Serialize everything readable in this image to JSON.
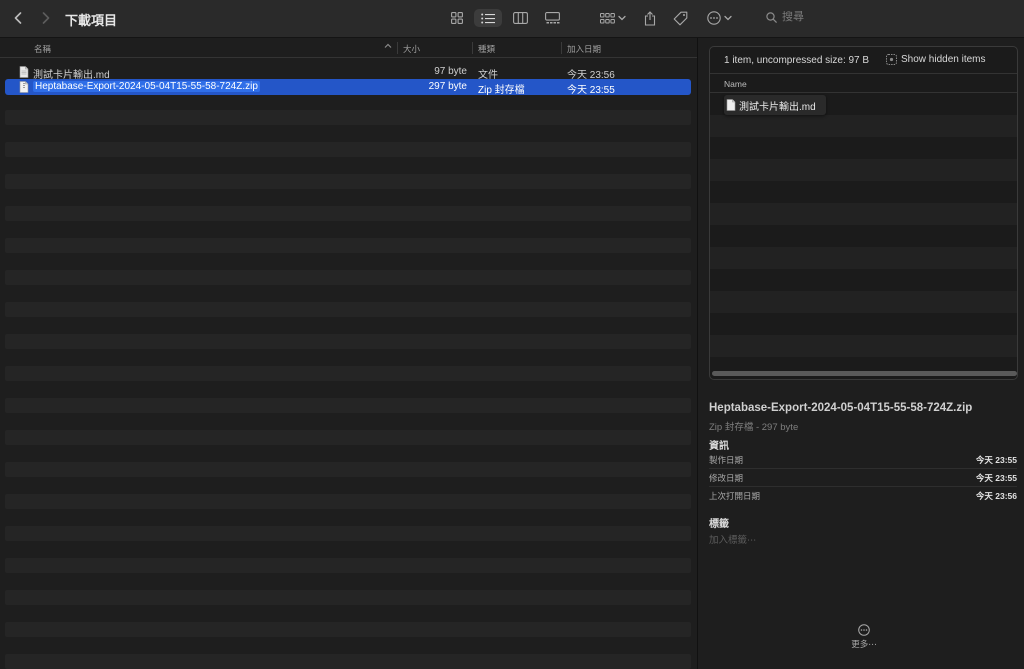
{
  "toolbar": {
    "title": "下載項目",
    "search_placeholder": "搜尋"
  },
  "list": {
    "columns": {
      "name": "名稱",
      "size": "大小",
      "kind": "種類",
      "date": "加入日期"
    },
    "rows": [
      {
        "name": "測試卡片輸出.md",
        "size": "97 byte",
        "kind": "文件",
        "date": "今天 23:56",
        "icon": "document-icon"
      },
      {
        "name": "Heptabase-Export-2024-05-04T15-55-58-724Z.zip",
        "size": "297 byte",
        "kind": "Zip 封存檔",
        "date": "今天 23:55",
        "icon": "zip-document-icon"
      }
    ]
  },
  "inspector": {
    "zip_summary": "1 item, uncompressed size: 97 B",
    "show_hidden_label": "Show hidden items",
    "zip_column_name": "Name",
    "zip_entry": "測試卡片輸出.md",
    "file_title": "Heptabase-Export-2024-05-04T15-55-58-724Z.zip",
    "file_subtitle": "Zip 封存檔 - 297 byte",
    "info_heading": "資訊",
    "info": [
      {
        "label": "製作日期",
        "value": "今天 23:55"
      },
      {
        "label": "修改日期",
        "value": "今天 23:55"
      },
      {
        "label": "上次打開日期",
        "value": "今天 23:56"
      }
    ],
    "tags_heading": "標籤",
    "tags_placeholder": "加入標籤⋯",
    "more_label": "更多⋯"
  },
  "colors": {
    "selection": "#2456c8",
    "background": "#1e1e1e",
    "toolbar": "#2a2a2a"
  }
}
